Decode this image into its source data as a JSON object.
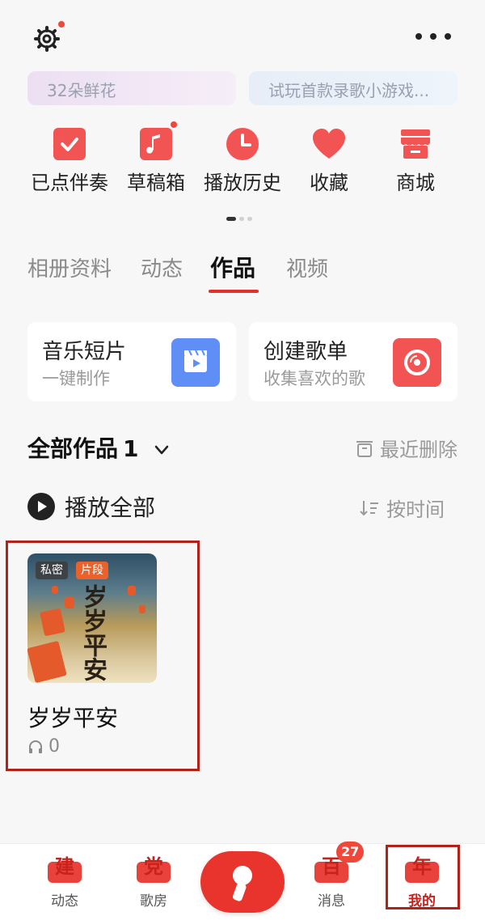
{
  "banners": {
    "left": "32朵鲜花",
    "right": "试玩首款录歌小游戏..."
  },
  "quick_actions": [
    {
      "label": "已点伴奏",
      "icon": "check-icon"
    },
    {
      "label": "草稿箱",
      "icon": "music-note-icon"
    },
    {
      "label": "播放历史",
      "icon": "clock-icon"
    },
    {
      "label": "收藏",
      "icon": "heart-icon"
    },
    {
      "label": "商城",
      "icon": "store-icon"
    }
  ],
  "tabs": [
    {
      "label": "相册资料",
      "active": false
    },
    {
      "label": "动态",
      "active": false
    },
    {
      "label": "作品",
      "active": true
    },
    {
      "label": "视频",
      "active": false
    }
  ],
  "cards": {
    "music_clip": {
      "title": "音乐短片",
      "subtitle": "一键制作"
    },
    "create_playlist": {
      "title": "创建歌单",
      "subtitle": "收集喜欢的歌"
    }
  },
  "works": {
    "title": "全部作品",
    "count": "1",
    "recent_deleted": "最近删除",
    "play_all": "播放全部",
    "sort": "按时间",
    "items": [
      {
        "title": "岁岁平安",
        "plays": "0",
        "tags": [
          "私密",
          "片段"
        ],
        "cover_text": "岁岁平安"
      }
    ]
  },
  "bottom_nav": [
    {
      "label": "动态",
      "badge_char": "建"
    },
    {
      "label": "歌房",
      "badge_char": "党"
    },
    {
      "label": "消息",
      "badge_char": "百",
      "notification": "27"
    },
    {
      "label": "我的",
      "badge_char": "年",
      "active": true
    }
  ],
  "colors": {
    "accent": "#e0312c",
    "red_icon": "#f25454",
    "blue_icon": "#5f8ef6",
    "dot": "#f0473b"
  }
}
